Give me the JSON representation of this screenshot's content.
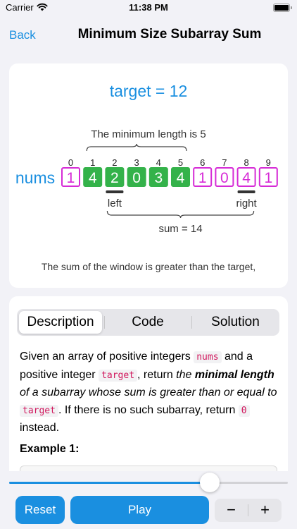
{
  "status_bar": {
    "carrier": "Carrier",
    "time": "11:38 PM",
    "battery_level": 1.0
  },
  "nav": {
    "back_label": "Back",
    "title": "Minimum Size Subarray Sum"
  },
  "visualization": {
    "target_text": "target = 12",
    "min_length_text": "The minimum length is 5",
    "array_label": "nums",
    "values": [
      1,
      4,
      2,
      0,
      3,
      4,
      1,
      0,
      4,
      1
    ],
    "indices": [
      0,
      1,
      2,
      3,
      4,
      5,
      6,
      7,
      8,
      9
    ],
    "window_start": 1,
    "window_end": 5,
    "left_pointer": 2,
    "right_pointer": 8,
    "left_label": "left",
    "right_label": "right",
    "sum_text": "sum = 14",
    "message": "The sum of the window is greater than the target,",
    "colors": {
      "accent": "#1a8fe0",
      "window": "#34b24a",
      "outside": "#d62bd6"
    }
  },
  "tabs": {
    "items": [
      "Description",
      "Code",
      "Solution"
    ],
    "selected": 0
  },
  "description": {
    "p1": "Given an array of positive integers ",
    "c1": "nums",
    "p2": " and a positive integer ",
    "c2": "target",
    "p3": ", return ",
    "i1": "the ",
    "b1": "minimal length",
    "i2": " of a subarray whose sum is greater than or equal to",
    "p4": " ",
    "c3": "target",
    "p5": ". If there is no such subarray, return ",
    "c4": "0",
    "p6": " instead.",
    "example_title": "Example 1:"
  },
  "slider": {
    "value": 0.72
  },
  "controls": {
    "reset_label": "Reset",
    "play_label": "Play",
    "minus_label": "−",
    "plus_label": "+"
  }
}
